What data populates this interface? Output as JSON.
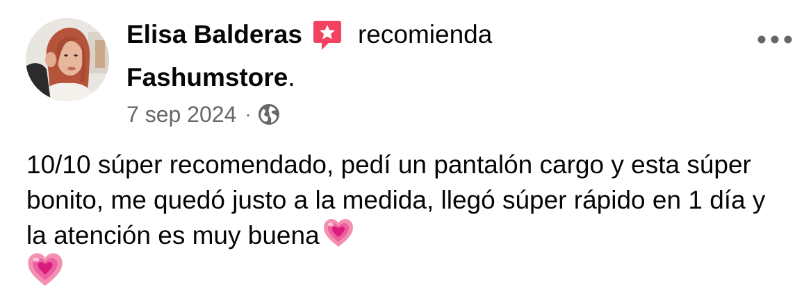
{
  "post": {
    "author_name": "Elisa Balderas",
    "recommend_verb": "recomienda",
    "page_name": "Fashumstore",
    "page_name_suffix": ".",
    "date": "7 sep 2024",
    "separator": "·",
    "body_text": "10/10 súper recomendado, pedí un pantalón cargo y esta súper bonito, me quedó justo a la medida, llegó súper rápido en 1 día y la atención es muy buena",
    "icons": {
      "avatar": "profile-photo",
      "badge": "recommendation-star-badge-icon",
      "privacy": "globe-icon",
      "more": "more-options-icon",
      "emoji": "growing-heart-emoji"
    },
    "colors": {
      "text_primary": "#050505",
      "text_secondary": "#65676b",
      "badge_red": "#f3425f",
      "heart_pink": "#f06292"
    }
  }
}
